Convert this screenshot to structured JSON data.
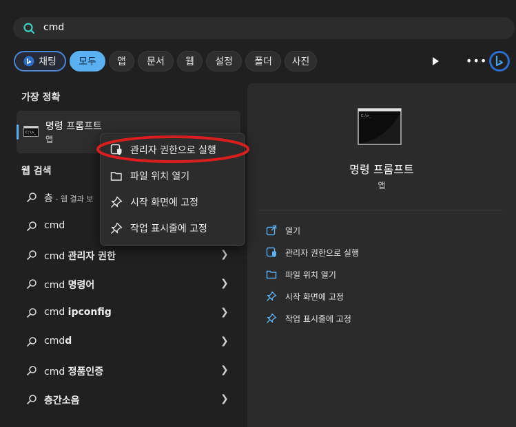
{
  "search": {
    "value": "cmd"
  },
  "filters": {
    "chat": "채팅",
    "all": "모두",
    "apps": "앱",
    "documents": "문서",
    "web": "웹",
    "settings": "설정",
    "folders": "폴더",
    "photos": "사진"
  },
  "left": {
    "best_match_title": "가장 정확",
    "best": {
      "name": "명령 프롬프트",
      "type": "앱"
    },
    "web_title": "웹 검색",
    "web_rows": [
      {
        "pre": "층",
        "bold": "",
        "suffix": " - 웹 결과 보"
      },
      {
        "pre": "cmd",
        "bold": "",
        "suffix": ""
      },
      {
        "pre": "cmd ",
        "bold": "관리자 권한",
        "suffix": ""
      },
      {
        "pre": "cmd ",
        "bold": "명령어",
        "suffix": ""
      },
      {
        "pre": "cmd ",
        "bold": "ipconfig",
        "suffix": ""
      },
      {
        "pre": "cmd",
        "bold": "d",
        "suffix": ""
      },
      {
        "pre": "cmd ",
        "bold": "정품인증",
        "suffix": ""
      },
      {
        "pre": "",
        "bold": "층간소음",
        "suffix": ""
      }
    ]
  },
  "context_menu": {
    "run_as_admin": "관리자 권한으로 실행",
    "open_location": "파일 위치 열기",
    "pin_start": "시작 화면에 고정",
    "pin_taskbar": "작업 표시줄에 고정"
  },
  "right": {
    "title": "명령 프롬프트",
    "subtitle": "앱",
    "actions": {
      "open": "열기",
      "run_as_admin": "관리자 권한으로 실행",
      "open_location": "파일 위치 열기",
      "pin_start": "시작 화면에 고정",
      "pin_taskbar": "작업 표시줄에 고정"
    }
  },
  "colors": {
    "accent": "#5ab0f0",
    "highlight_ring": "#d81e1e"
  }
}
